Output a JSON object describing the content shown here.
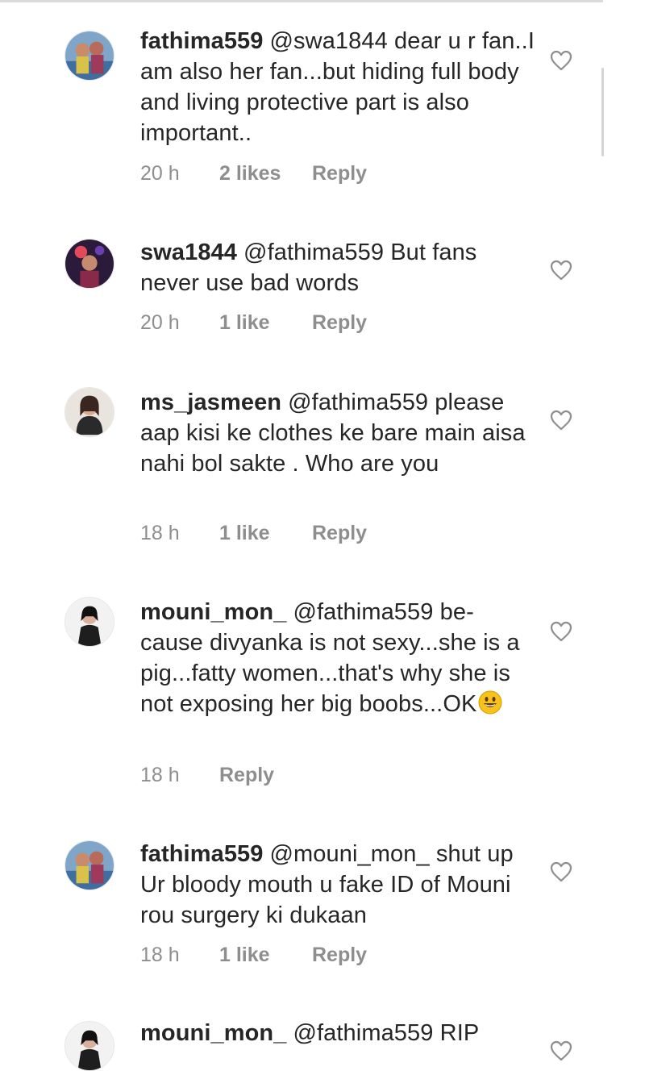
{
  "comments": [
    {
      "username": "fathima559",
      "text": "@swa1844 dear u r fan..I am also her fan...but hiding full body and living protective part is also important..",
      "time": "20 h",
      "likes": "2 likes",
      "reply": "Reply",
      "avatar_icon": "user-avatar-icon"
    },
    {
      "username": "swa1844",
      "text": "@fathima559 But fans never use bad words",
      "time": "20 h",
      "likes": "1 like",
      "reply": "Reply",
      "avatar_icon": "user-avatar-icon"
    },
    {
      "username": "ms_jasmeen",
      "text": "@fathima559 please aap kisi ke clothes ke bare main aisa nahi bol sakte . Who are you",
      "time": "18 h",
      "likes": "1 like",
      "reply": "Reply",
      "avatar_icon": "user-avatar-icon"
    },
    {
      "username": "mouni_mon_",
      "text": "@fathima559 be-cause divyanka is not sexy...she is a pig...fatty women...that's why she is not exposing her big boobs...OK",
      "emoji": "grinning-face-emoji",
      "time": "18 h",
      "likes": "",
      "reply": "Reply",
      "avatar_icon": "user-avatar-icon"
    },
    {
      "username": "fathima559",
      "text": "@mouni_mon_ shut up Ur bloody mouth u fake ID of Mouni rou surgery ki dukaan",
      "time": "18 h",
      "likes": "1 like",
      "reply": "Reply",
      "avatar_icon": "user-avatar-icon"
    },
    {
      "username": "mouni_mon_",
      "text": "@fathima559 RIP",
      "time": "",
      "likes": "",
      "reply": "",
      "avatar_icon": "user-avatar-icon"
    }
  ],
  "colors": {
    "text": "#262626",
    "meta": "#8e8e8e",
    "heart_stroke": "#8e8e8e",
    "emoji": "#f7c21a"
  },
  "icons": {
    "like": "heart-outline-icon"
  }
}
